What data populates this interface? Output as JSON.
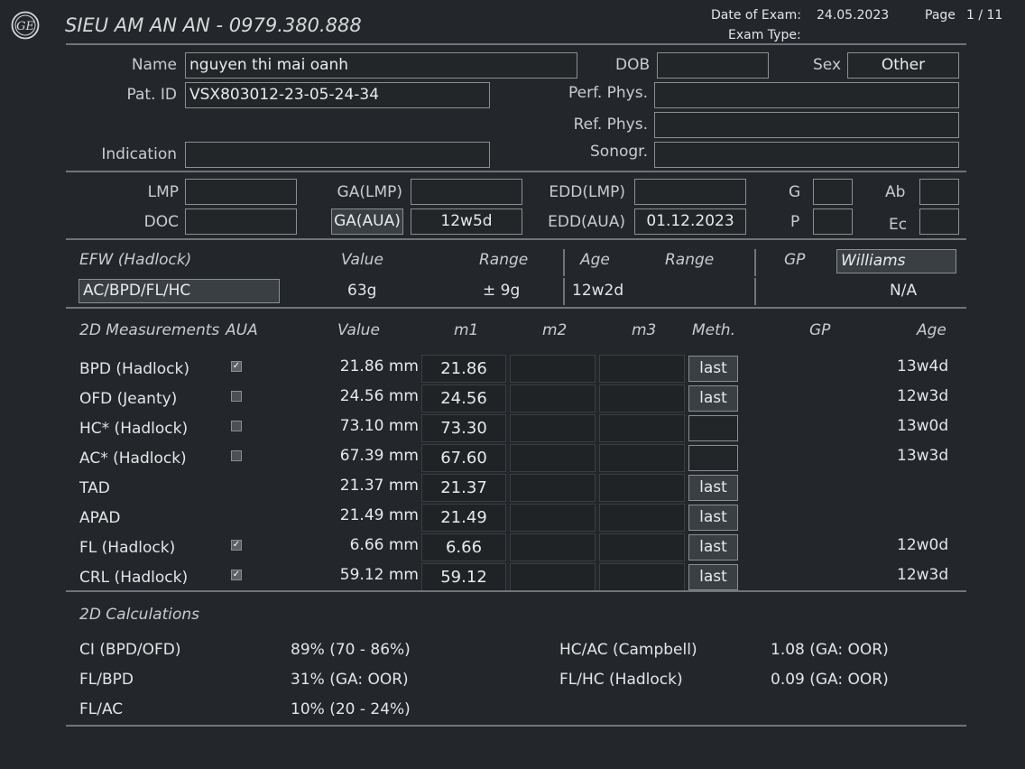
{
  "header": {
    "title": "SIEU AM AN AN - 0979.380.888",
    "date_label": "Date of Exam:",
    "date_value": "24.05.2023",
    "page_label": "Page",
    "page_value": "1 / 11",
    "exam_type_label": "Exam Type:"
  },
  "patient": {
    "name_label": "Name",
    "name_value": "nguyen thi mai oanh",
    "dob_label": "DOB",
    "dob_value": "",
    "sex_label": "Sex",
    "sex_value": "Other",
    "patid_label": "Pat. ID",
    "patid_value": "VSX803012-23-05-24-34",
    "perf_label": "Perf. Phys.",
    "perf_value": "",
    "ref_label": "Ref. Phys.",
    "ref_value": "",
    "indication_label": "Indication",
    "indication_value": "",
    "sonogr_label": "Sonogr.",
    "sonogr_value": ""
  },
  "dating": {
    "lmp_label": "LMP",
    "lmp_value": "",
    "doc_label": "DOC",
    "doc_value": "",
    "galmp_label": "GA(LMP)",
    "galmp_value": "",
    "gaaua_label": "GA(AUA)",
    "gaaua_value": "12w5d",
    "eddlmp_label": "EDD(LMP)",
    "eddlmp_value": "",
    "eddaua_label": "EDD(AUA)",
    "eddaua_value": "01.12.2023",
    "g_label": "G",
    "g_value": "",
    "p_label": "P",
    "p_value": "",
    "ab_label": "Ab",
    "ab_value": "",
    "ec_label": "Ec",
    "ec_value": ""
  },
  "efw": {
    "title": "EFW (Hadlock)",
    "value_header": "Value",
    "range_header": "Range",
    "age_header": "Age",
    "age_range_header": "Range",
    "gp_header": "GP",
    "gp_select": "Williams",
    "formula": "AC/BPD/FL/HC",
    "value": "63g",
    "range": "± 9g",
    "age": "12w2d",
    "gp_value": "N/A"
  },
  "measurements": {
    "headers": {
      "title": "2D Measurements",
      "aua": "AUA",
      "value": "Value",
      "m1": "m1",
      "m2": "m2",
      "m3": "m3",
      "meth": "Meth.",
      "gp": "GP",
      "age": "Age"
    },
    "rows": [
      {
        "label": "BPD (Hadlock)",
        "aua": true,
        "value": "21.86 mm",
        "m1": "21.86",
        "meth": "last",
        "age": "13w4d"
      },
      {
        "label": "OFD (Jeanty)",
        "aua": false,
        "value": "24.56 mm",
        "m1": "24.56",
        "meth": "last",
        "age": "12w3d"
      },
      {
        "label": "HC* (Hadlock)",
        "aua": false,
        "value": "73.10 mm",
        "m1": "73.30",
        "meth": "",
        "age": "13w0d"
      },
      {
        "label": "AC* (Hadlock)",
        "aua": false,
        "value": "67.39 mm",
        "m1": "67.60",
        "meth": "",
        "age": "13w3d"
      },
      {
        "label": "TAD",
        "aua": null,
        "value": "21.37 mm",
        "m1": "21.37",
        "meth": "last",
        "age": ""
      },
      {
        "label": "APAD",
        "aua": null,
        "value": "21.49 mm",
        "m1": "21.49",
        "meth": "last",
        "age": ""
      },
      {
        "label": "FL (Hadlock)",
        "aua": true,
        "value": "6.66 mm",
        "m1": "6.66",
        "meth": "last",
        "age": "12w0d"
      },
      {
        "label": "CRL (Hadlock)",
        "aua": true,
        "value": "59.12 mm",
        "m1": "59.12",
        "meth": "last",
        "age": "12w3d"
      }
    ]
  },
  "calculations": {
    "title": "2D Calculations",
    "items": [
      {
        "label": "CI (BPD/OFD)",
        "value": "89% (70 - 86%)"
      },
      {
        "label": "FL/BPD",
        "value": "31% (GA: OOR)"
      },
      {
        "label": "FL/AC",
        "value": "10% (20 - 24%)"
      },
      {
        "label": "HC/AC (Campbell)",
        "value": "1.08 (GA: OOR)"
      },
      {
        "label": "FL/HC (Hadlock)",
        "value": "0.09 (GA: OOR)"
      }
    ]
  },
  "colors": {
    "background": "#23272b",
    "text": "#d6d8da",
    "border": "#8a8f94"
  },
  "logo": {
    "icon": "ge-logo-icon"
  }
}
